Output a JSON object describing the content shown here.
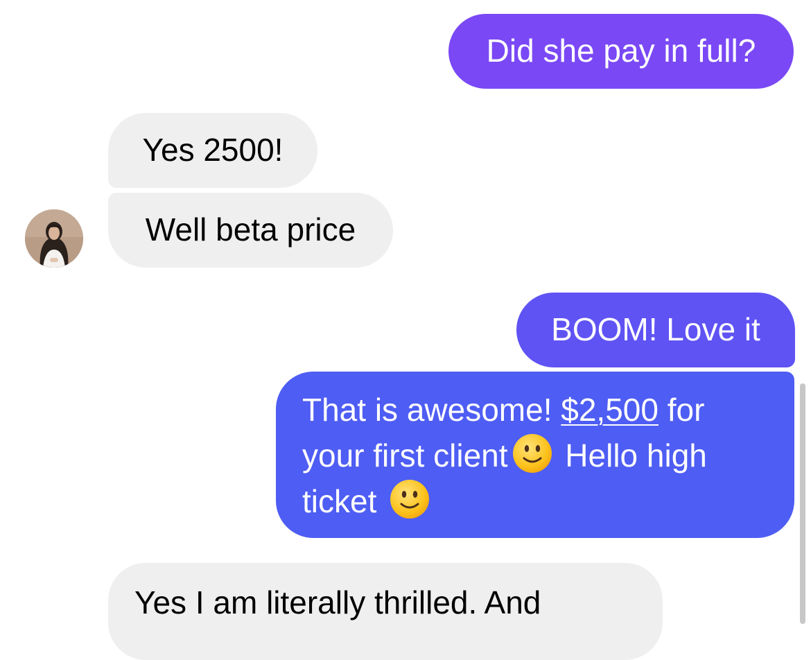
{
  "conversation": {
    "messages": [
      {
        "sender": "me",
        "text": "Did she pay in full?"
      },
      {
        "sender": "contact",
        "text": "Yes 2500!"
      },
      {
        "sender": "contact",
        "text": "Well beta price"
      },
      {
        "sender": "me",
        "text": "BOOM! Love it"
      },
      {
        "sender": "me",
        "part1": "That is awesome! ",
        "link": "$2,500",
        "part2": " for your first client",
        "part3": " Hello high ticket",
        "emoji": "slightly-smiling-face"
      },
      {
        "sender": "contact",
        "text": "Yes I am literally thrilled. And"
      }
    ]
  },
  "contact": {
    "avatar_icon": "profile-photo-woman"
  },
  "colors": {
    "outgoing_top": "#7a48f5",
    "outgoing_mid": "#5f53f4",
    "outgoing_bottom": "#4e5df3",
    "incoming": "#efefef"
  }
}
